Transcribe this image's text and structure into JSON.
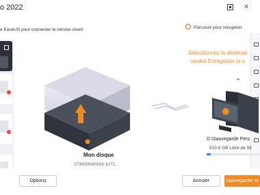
{
  "window": {
    "title": "o 2022",
    "close_glyph": "×"
  },
  "header": {
    "subtitle": "e EaseUS pour connecter le service cloud",
    "browse_label": "Parcourir pour récupérer"
  },
  "source": {
    "name": "Mon disque",
    "subtext": "ST4000NM0024-1HT1..."
  },
  "destination": {
    "prompt_line1": "Sélectionnez la destinati",
    "prompt_line2": "voulez Enregistrer la s",
    "name": "D:\\Sauvegarde Pers",
    "free": "533.6 GB Libre de 58",
    "used_fraction": 0.08
  },
  "footer": {
    "options_label": "Options",
    "cancel_label": "Annuler",
    "save_label": "Sauvegarder m"
  },
  "colors": {
    "accent": "#f08a24",
    "dark": "#2d323a",
    "link": "#3b82f6"
  },
  "icons": [
    "gear-icon",
    "history-icon",
    "cloud-icon",
    "drive-icon",
    "clone-icon",
    "tools-icon",
    "list-icon",
    "edit-icon"
  ]
}
